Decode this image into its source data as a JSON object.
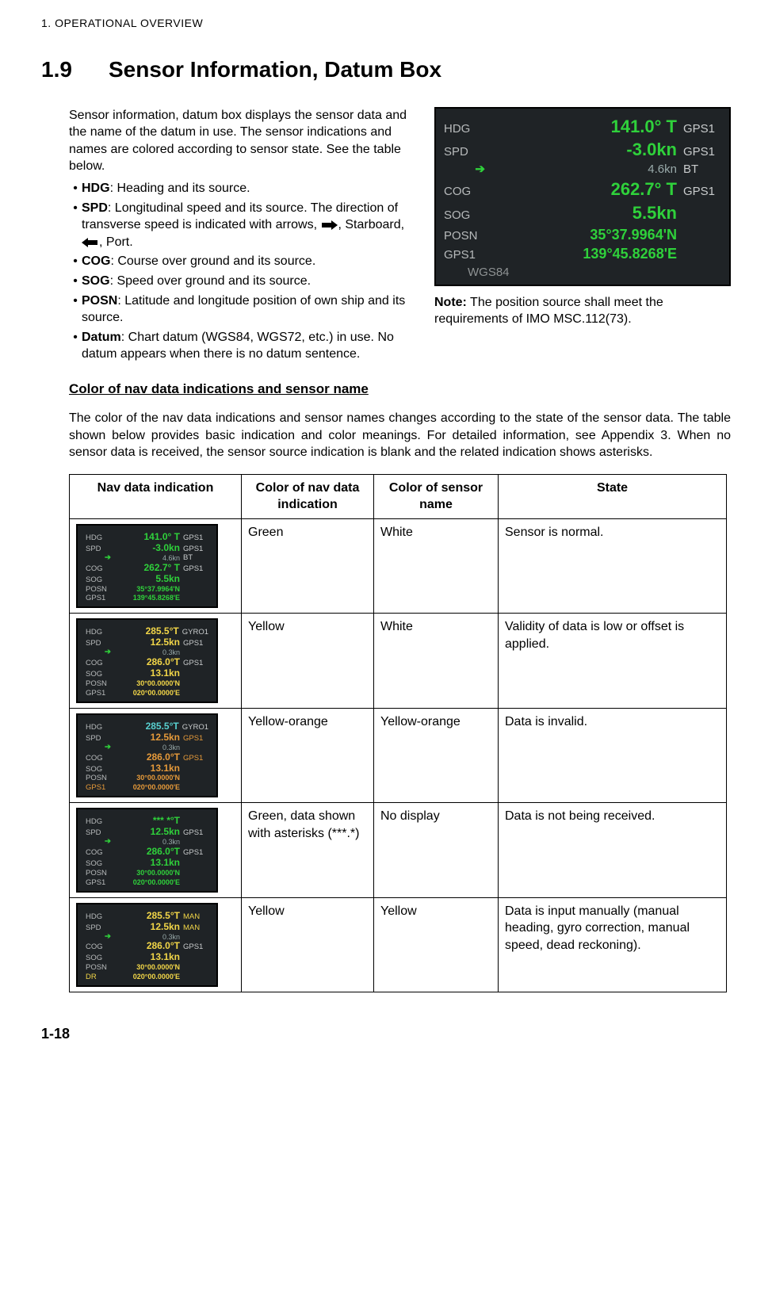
{
  "header": {
    "chapter": "1.  OPERATIONAL OVERVIEW"
  },
  "section": {
    "number": "1.9",
    "title": "Sensor Information, Datum Box"
  },
  "intro": {
    "lead": "Sensor information, datum box displays the sensor data and the name of the datum in use. The sensor indications and names are colored according to sensor state. See the table below.",
    "bullets": [
      {
        "label": "HDG",
        "text": ": Heading and its source."
      },
      {
        "label": "SPD",
        "text_a": ": Longitudinal speed and its source. The direction of transverse speed is indicated with arrows, ",
        "text_b": ", Starboard, ",
        "text_c": ", Port."
      },
      {
        "label": "COG",
        "text": ": Course over ground and its source."
      },
      {
        "label": "SOG",
        "text": ": Speed over ground and its source."
      },
      {
        "label": "POSN",
        "text": ": Latitude and longitude position of own ship and its source."
      },
      {
        "label": "Datum",
        "text": ": Chart datum (WGS84, WGS72, etc.) in use. No datum appears when there is no datum sentence."
      }
    ],
    "note_label": "Note:",
    "note_text": " The position source shall meet the requirements of IMO MSC.112(73)."
  },
  "datum_box_big": {
    "hdg": {
      "label": "HDG",
      "value": "141.0° T",
      "source": "GPS1"
    },
    "spd": {
      "label": "SPD",
      "value": "-3.0kn",
      "source": "GPS1",
      "sub_arrow": "➔",
      "sub_value": "4.6kn",
      "sub_source": "BT"
    },
    "cog": {
      "label": "COG",
      "value": "262.7° T",
      "source": "GPS1"
    },
    "sog": {
      "label": "SOG",
      "value": "5.5kn",
      "source": ""
    },
    "posn": {
      "label": "POSN",
      "src_label": "GPS1",
      "lat": "35°37.9964'N",
      "lon": "139°45.8268'E"
    },
    "datum": "WGS84"
  },
  "subhead": "Color of nav data indications and sensor name",
  "para2": "The color of the nav data indications and sensor names changes according to the state of the sensor data. The table shown below provides basic indication and color meanings. For detailed information, see Appendix 3. When no sensor data is received, the sensor source indication is blank and the related indication shows asterisks.",
  "table": {
    "headers": [
      "Nav data indication",
      "Color of nav data indication",
      "Color of sensor name",
      "State"
    ],
    "rows": [
      {
        "nav_color": "Green",
        "name_color": "White",
        "state": "Sensor is normal."
      },
      {
        "nav_color": "Yellow",
        "name_color": "White",
        "state": "Validity of data is low or offset is applied."
      },
      {
        "nav_color": "Yellow-orange",
        "name_color": "Yellow-orange",
        "state": "Data is invalid."
      },
      {
        "nav_color": "Green, data shown with asterisks (***.*)",
        "name_color": "No display",
        "state": "Data is not being received."
      },
      {
        "nav_color": "Yellow",
        "name_color": "Yellow",
        "state": "Data is input manually (manual heading, gyro correction, manual speed, dead reckoning)."
      }
    ]
  },
  "thumbs": {
    "normal": {
      "hdg_val": "141.0° T",
      "hdg_src": "GPS1",
      "spd_val": "-3.0kn",
      "spd_src": "GPS1",
      "spd_sub": "4.6kn",
      "spd_subsrc": "BT",
      "cog_val": "262.7° T",
      "cog_src": "GPS1",
      "sog_val": "5.5kn",
      "posn_lat": "35°37.9964'N",
      "posn_lon": "139°45.8268'E",
      "posn_src": "GPS1"
    },
    "yellow_white": {
      "hdg_val": "285.5°T",
      "hdg_src": "GYRO1",
      "spd_val": "12.5kn",
      "spd_src": "GPS1",
      "spd_sub": "0.3kn",
      "cog_val": "286.0°T",
      "cog_src": "GPS1",
      "sog_val": "13.1kn",
      "posn_lat": "30°00.0000'N",
      "posn_lon": "020°00.0000'E",
      "posn_src": "GPS1"
    },
    "orange": {
      "hdg_val": "285.5°T",
      "hdg_src": "GYRO1",
      "spd_val": "12.5kn",
      "spd_src": "GPS1",
      "spd_sub": "0.3kn",
      "cog_val": "286.0°T",
      "cog_src": "GPS1",
      "sog_val": "13.1kn",
      "posn_lat": "30°00.0000'N",
      "posn_lon": "020°00.0000'E",
      "posn_src": "GPS1"
    },
    "asterisks": {
      "hdg_val": "*** *°T",
      "spd_val": "12.5kn",
      "spd_src": "GPS1",
      "spd_sub": "0.3kn",
      "cog_val": "286.0°T",
      "cog_src": "GPS1",
      "sog_val": "13.1kn",
      "posn_lat": "30°00.0000'N",
      "posn_lon": "020°00.0000'E",
      "posn_src": "GPS1"
    },
    "manual": {
      "hdg_val": "285.5°T",
      "hdg_src": "MAN",
      "spd_val": "12.5kn",
      "spd_src": "MAN",
      "spd_sub": "0.3kn",
      "cog_val": "286.0°T",
      "cog_src": "GPS1",
      "sog_val": "13.1kn",
      "posn_lat": "30°00.0000'N",
      "posn_lon": "020°00.0000'E",
      "posn_src": "DR"
    },
    "labels": {
      "hdg": "HDG",
      "spd": "SPD",
      "cog": "COG",
      "sog": "SOG",
      "posn": "POSN",
      "arrow": "➔"
    }
  },
  "footer": {
    "page": "1-18"
  }
}
